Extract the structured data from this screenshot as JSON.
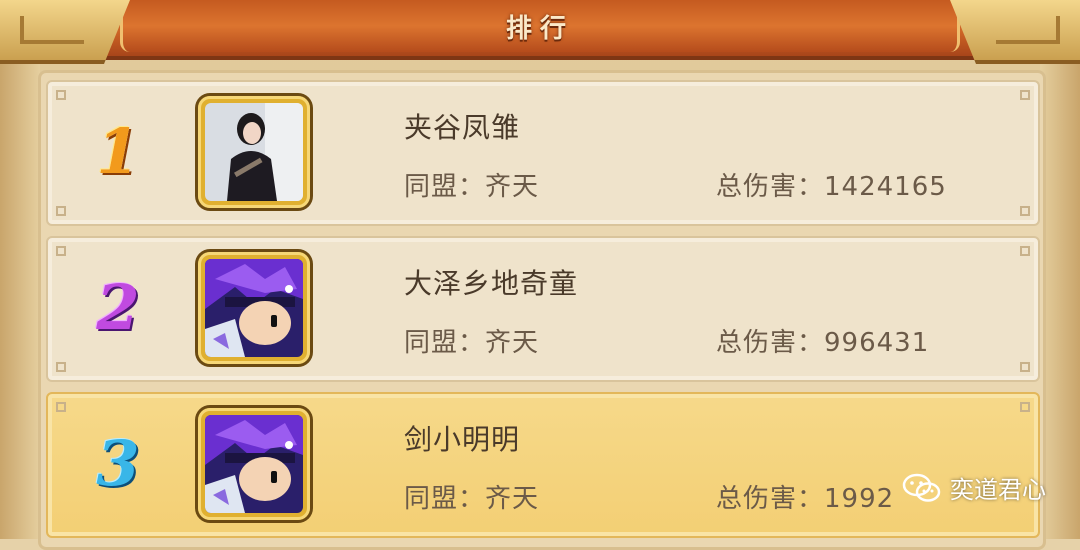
{
  "header": {
    "title": "排行"
  },
  "rows": [
    {
      "rank": "1",
      "name": "夹谷凤雏",
      "alliance": "同盟：齐天",
      "damage": "总伤害：1424165",
      "avatar": "portrait-photo"
    },
    {
      "rank": "2",
      "name": "大泽乡地奇童",
      "alliance": "同盟：齐天",
      "damage": "总伤害：996431",
      "avatar": "purple-hair-hero"
    },
    {
      "rank": "3",
      "name": "剑小明明",
      "alliance": "同盟：齐天",
      "damage": "总伤害：1992",
      "avatar": "purple-hair-hero"
    }
  ],
  "watermark": {
    "text": "奕道君心",
    "icon": "wechat-icon"
  },
  "colors": {
    "rank1": "#f29a1c",
    "rank2": "#c04ae0",
    "rank3": "#39b6e8",
    "header": "#cf6626",
    "highlight_row": "#f3cf74"
  }
}
